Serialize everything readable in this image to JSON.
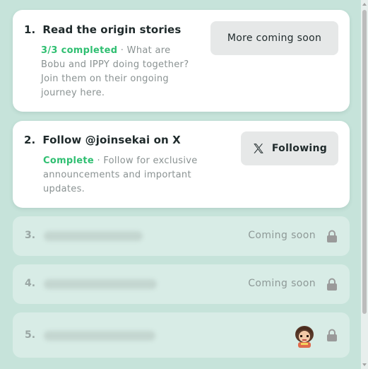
{
  "tasks": [
    {
      "num": "1.",
      "title": "Read the origin stories",
      "status": "3/3 completed",
      "description": " · What are Bobu and IPPY doing together? Join them on their ongoing journey here.",
      "button": "More coming soon"
    },
    {
      "num": "2.",
      "title": "Follow @joinsekai on X",
      "status": "Complete",
      "description": " · Follow for exclusive announcements and important updates.",
      "button": "Following"
    }
  ],
  "locked_tasks": [
    {
      "num": "3.",
      "status": "Coming soon"
    },
    {
      "num": "4.",
      "status": "Coming soon"
    },
    {
      "num": "5.",
      "status": ""
    }
  ],
  "colors": {
    "background": "#c6e3da",
    "card": "#ffffff",
    "locked_card": "#d8ece6",
    "success": "#2fbf71",
    "button": "#e6e8e8"
  },
  "icons": [
    "x-logo-icon",
    "lock-icon",
    "avatar"
  ]
}
